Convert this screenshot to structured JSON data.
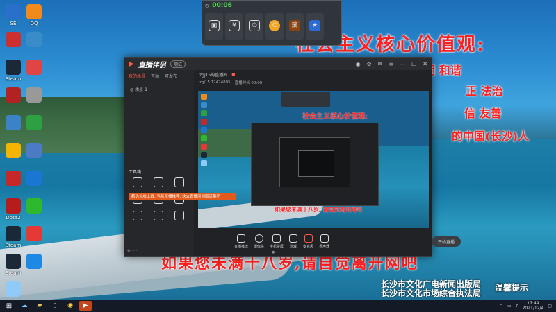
{
  "desktop": {
    "icons": [
      {
        "label": "SE",
        "color": "#2a6fc9"
      },
      {
        "label": "QQ",
        "color": "#f08a1c"
      },
      {
        "label": "",
        "color": "#cc3030"
      },
      {
        "label": "",
        "color": "#3a8cc8"
      },
      {
        "label": "Steam",
        "color": "#1b2838"
      },
      {
        "label": "",
        "color": "#e04545"
      },
      {
        "label": "",
        "color": "#b22222"
      },
      {
        "label": "",
        "color": "#999999"
      },
      {
        "label": "",
        "color": "#3b83c7"
      },
      {
        "label": "",
        "color": "#2ea043"
      },
      {
        "label": "",
        "color": "#f4b400"
      },
      {
        "label": "",
        "color": "#4a7bc4"
      },
      {
        "label": "",
        "color": "#c62828"
      },
      {
        "label": "",
        "color": "#1976d2"
      },
      {
        "label": "Dota2",
        "color": "#b71c1c"
      },
      {
        "label": "",
        "color": "#2eb82e"
      },
      {
        "label": "Steam",
        "color": "#1b2838"
      },
      {
        "label": "",
        "color": "#e53935"
      },
      {
        "label": "Steam",
        "color": "#1b2838"
      },
      {
        "label": "",
        "color": "#1e88e5"
      },
      {
        "label": "",
        "color": "#90caf9"
      }
    ],
    "slogan_main": "社会主义核心价值观:",
    "values_line1": "明 和谐",
    "values_line2": "正 法治",
    "values_line3": "信 友善",
    "values_line4": "的中国(长沙)人",
    "warning": "如果您未满十八岁,请自觉离开网吧",
    "bureau1": "长沙市文化广电新闻出版局",
    "bureau2": "长沙市文化市场综合执法局",
    "notice": "温馨提示"
  },
  "toolbar": {
    "timer": "00:06",
    "buttons": [
      "",
      "",
      "",
      "",
      "",
      ""
    ],
    "accent": "#4ee04e"
  },
  "app": {
    "title": "直播伴侣",
    "version": "测试",
    "side_tabs": [
      "我的场景",
      "互动",
      "可发布"
    ],
    "scene": "场景 1",
    "tools_header": "工具箱",
    "tip": "精选化妆上线, 当场所播推荐, 快去直播间领取流量吧",
    "tools": [
      "",
      "",
      "",
      "",
      "",
      "",
      "",
      "",
      ""
    ],
    "main_title": "zgj15的直播间",
    "main_sub": "zgj15  12424895",
    "main_tag": "直播时长 00:00",
    "controls": [
      "直播推流",
      "摄像头",
      "手机投屏",
      "游戏",
      "麦克风",
      "扬声器"
    ],
    "start_label": "开始直播",
    "accent": "#ff5a47",
    "preview_slogan": "社会主义核心价值观:",
    "preview_warning": "如果您未满十八岁, 请自觉离开网吧"
  },
  "taskbar": {
    "time": "17:49",
    "date": "2021/12/4"
  }
}
